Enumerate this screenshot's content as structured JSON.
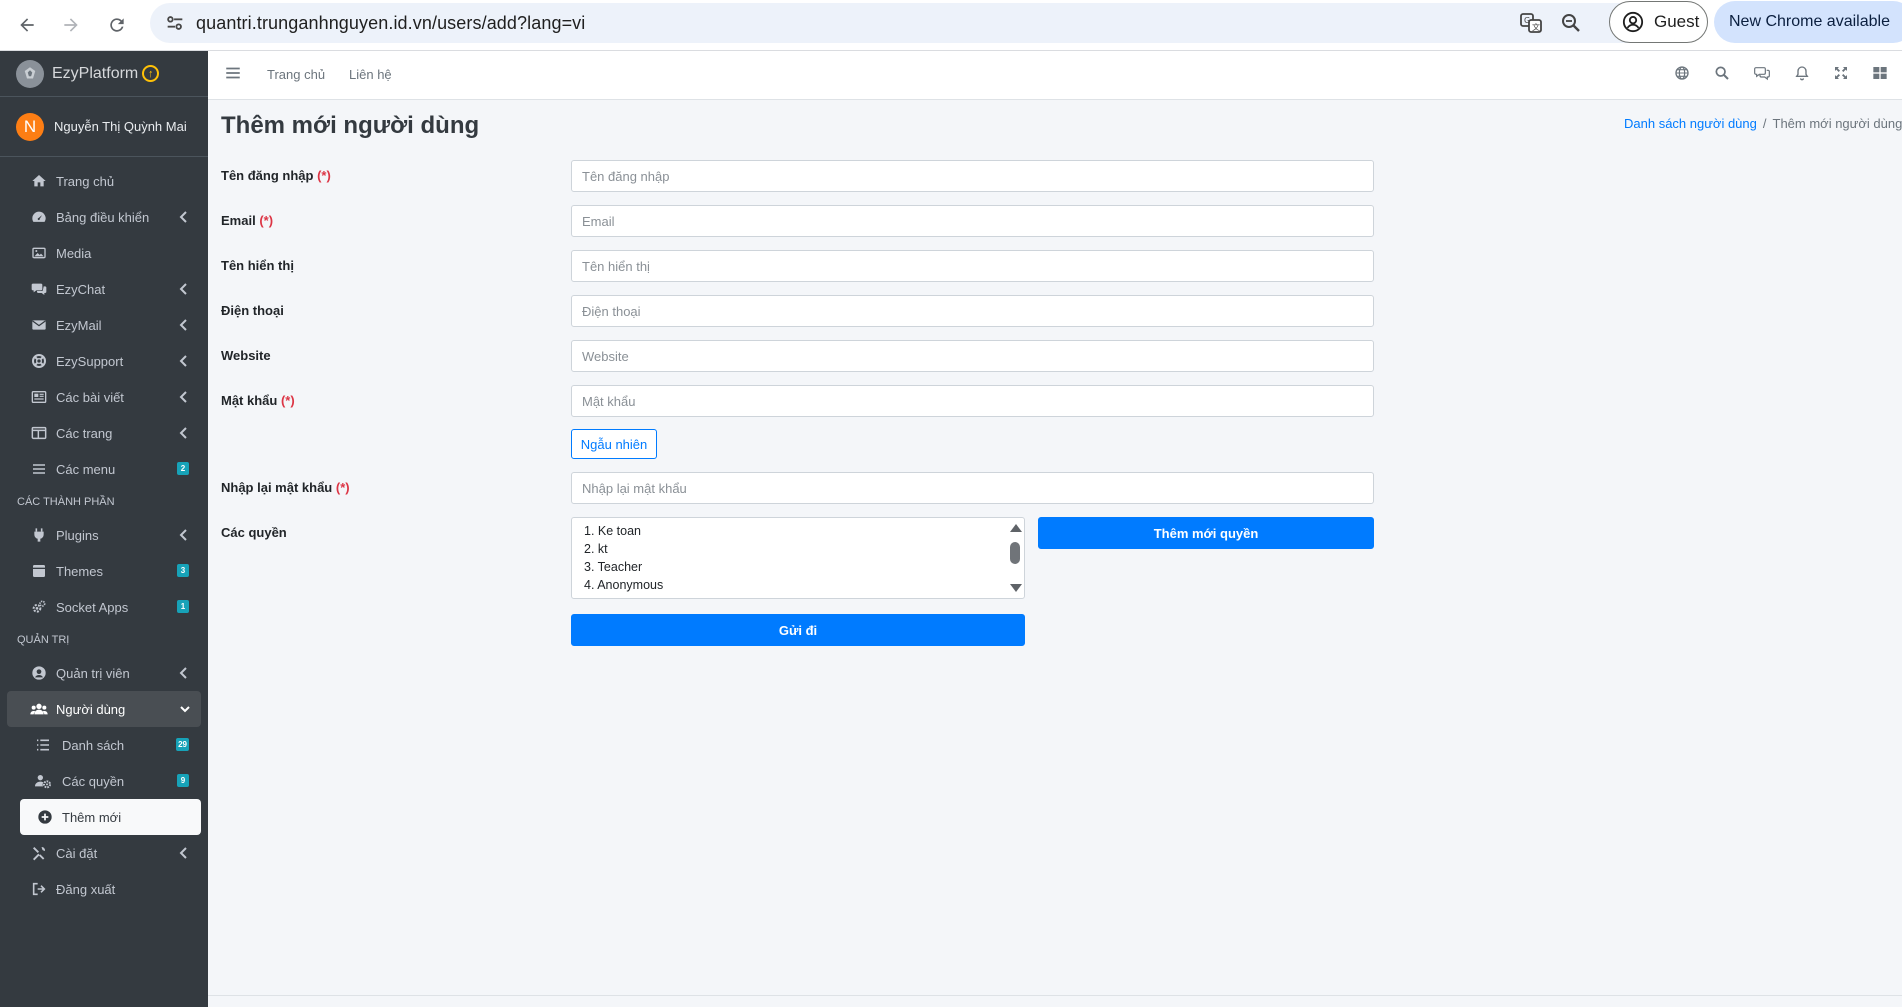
{
  "browser": {
    "url": "quantri.trunganhnguyen.id.vn/users/add?lang=vi",
    "guest_label": "Guest",
    "update_label": "New Chrome available"
  },
  "sidebar": {
    "brand": "EzyPlatform",
    "user": {
      "initial": "N",
      "name": "Nguyễn Thị Quỳnh Mai"
    },
    "items": [
      {
        "label": "Trang chủ"
      },
      {
        "label": "Bảng điều khiển"
      },
      {
        "label": "Media"
      },
      {
        "label": "EzyChat"
      },
      {
        "label": "EzyMail"
      },
      {
        "label": "EzySupport"
      },
      {
        "label": "Các bài viết"
      },
      {
        "label": "Các trang"
      },
      {
        "label": "Các menu",
        "badge": "2"
      }
    ],
    "section_components": "CÁC THÀNH PHẦN",
    "component_items": [
      {
        "label": "Plugins"
      },
      {
        "label": "Themes",
        "badge": "3"
      },
      {
        "label": "Socket Apps",
        "badge": "1"
      }
    ],
    "section_admin": "QUẢN TRỊ",
    "admin_items": [
      {
        "label": "Quản trị viên"
      },
      {
        "label": "Người dùng"
      },
      {
        "label": "Danh sách",
        "badge": "29"
      },
      {
        "label": "Các quyền",
        "badge": "9"
      },
      {
        "label": "Thêm mới"
      },
      {
        "label": "Cài đặt"
      },
      {
        "label": "Đăng xuất"
      }
    ]
  },
  "topnav": {
    "links": [
      "Trang chủ",
      "Liên hệ"
    ]
  },
  "page": {
    "title": "Thêm mới người dùng",
    "breadcrumb": {
      "parent": "Danh sách người dùng",
      "separator": "/",
      "current": "Thêm mới người dùng"
    }
  },
  "form": {
    "username": {
      "label": "Tên đăng nhập",
      "placeholder": "Tên đăng nhập"
    },
    "email": {
      "label": "Email",
      "placeholder": "Email"
    },
    "display_name": {
      "label": "Tên hiển thị",
      "placeholder": "Tên hiển thị"
    },
    "phone": {
      "label": "Điện thoại",
      "placeholder": "Điện thoại"
    },
    "website": {
      "label": "Website",
      "placeholder": "Website"
    },
    "password": {
      "label": "Mật khẩu",
      "placeholder": "Mật khẩu"
    },
    "random_button": "Ngẫu nhiên",
    "confirm_password": {
      "label": "Nhập lại mật khẩu",
      "placeholder": "Nhập lại mật khẩu"
    },
    "roles": {
      "label": "Các quyền",
      "options": [
        "1. Ke toan",
        "2. kt",
        "3. Teacher",
        "4. Anonymous"
      ]
    },
    "add_role_button": "Thêm mới quyền",
    "submit_button": "Gửi đi",
    "required_mark": "(*)"
  },
  "colors": {
    "sidebar_bg": "#343a40",
    "primary": "#007bff",
    "badge": "#17a2b8",
    "required": "#dc3545",
    "avatar": "#fd7e14"
  }
}
